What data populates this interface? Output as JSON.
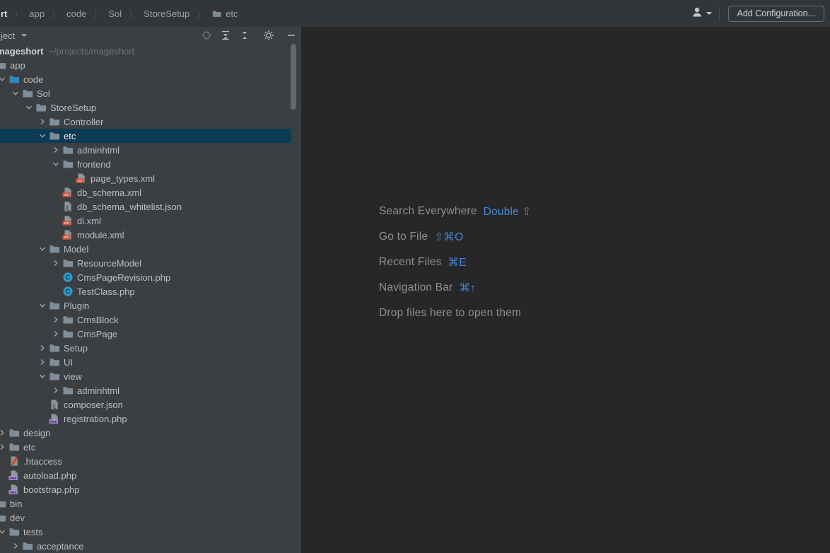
{
  "titlebar": {
    "breadcrumbs": [
      "rt",
      "app",
      "code",
      "Sol",
      "StoreSetup",
      "etc"
    ],
    "breadcrumb_folder_item": "etc",
    "add_configuration_label": "Add Configuration...",
    "user_icon": "user-dropdown"
  },
  "project_panel": {
    "title": "ject",
    "actions": [
      {
        "name": "select-opened-file",
        "icon": "locate-icon"
      },
      {
        "name": "expand-all",
        "icon": "expand-all-icon"
      },
      {
        "name": "collapse-all",
        "icon": "collapse-all-icon"
      },
      {
        "name": "settings",
        "icon": "gear-icon"
      },
      {
        "name": "hide",
        "icon": "minus-icon"
      }
    ],
    "tree": [
      {
        "label": "mageshort",
        "suffix": "~/projects/mageshort",
        "level": 0,
        "chevron": "open",
        "icon": "folder",
        "bold": true
      },
      {
        "label": "app",
        "level": 1,
        "chevron": "open",
        "icon": "folder"
      },
      {
        "label": "code",
        "level": 2,
        "chevron": "open",
        "icon": "folder-source"
      },
      {
        "label": "Sol",
        "level": 3,
        "chevron": "open",
        "icon": "folder"
      },
      {
        "label": "StoreSetup",
        "level": 4,
        "chevron": "open",
        "icon": "folder"
      },
      {
        "label": "Controller",
        "level": 5,
        "chevron": "closed",
        "icon": "folder"
      },
      {
        "label": "etc",
        "level": 5,
        "chevron": "open",
        "icon": "folder",
        "selected": true
      },
      {
        "label": "adminhtml",
        "level": 6,
        "chevron": "closed",
        "icon": "folder"
      },
      {
        "label": "frontend",
        "level": 6,
        "chevron": "open",
        "icon": "folder"
      },
      {
        "label": "page_types.xml",
        "level": 7,
        "chevron": null,
        "icon": "xml-file"
      },
      {
        "label": "db_schema.xml",
        "level": 6,
        "chevron": null,
        "icon": "xml-file"
      },
      {
        "label": "db_schema_whitelist.json",
        "level": 6,
        "chevron": null,
        "icon": "json-file"
      },
      {
        "label": "di.xml",
        "level": 6,
        "chevron": null,
        "icon": "xml-file"
      },
      {
        "label": "module.xml",
        "level": 6,
        "chevron": null,
        "icon": "xml-file"
      },
      {
        "label": "Model",
        "level": 5,
        "chevron": "open",
        "icon": "folder"
      },
      {
        "label": "ResourceModel",
        "level": 6,
        "chevron": "closed",
        "icon": "folder"
      },
      {
        "label": "CmsPageRevision.php",
        "level": 6,
        "chevron": null,
        "icon": "php-class"
      },
      {
        "label": "TestClass.php",
        "level": 6,
        "chevron": null,
        "icon": "php-class"
      },
      {
        "label": "Plugin",
        "level": 5,
        "chevron": "open",
        "icon": "folder"
      },
      {
        "label": "CmsBlock",
        "level": 6,
        "chevron": "closed",
        "icon": "folder"
      },
      {
        "label": "CmsPage",
        "level": 6,
        "chevron": "closed",
        "icon": "folder"
      },
      {
        "label": "Setup",
        "level": 5,
        "chevron": "closed",
        "icon": "folder"
      },
      {
        "label": "UI",
        "level": 5,
        "chevron": "closed",
        "icon": "folder"
      },
      {
        "label": "view",
        "level": 5,
        "chevron": "open",
        "icon": "folder"
      },
      {
        "label": "adminhtml",
        "level": 6,
        "chevron": "closed",
        "icon": "folder"
      },
      {
        "label": "composer.json",
        "level": 5,
        "chevron": null,
        "icon": "json-file"
      },
      {
        "label": "registration.php",
        "level": 5,
        "chevron": null,
        "icon": "php-file"
      },
      {
        "label": "design",
        "level": 2,
        "chevron": "closed",
        "icon": "folder"
      },
      {
        "label": "etc",
        "level": 2,
        "chevron": "closed",
        "icon": "folder"
      },
      {
        "label": ".htaccess",
        "level": 2,
        "chevron": null,
        "icon": "htaccess-file"
      },
      {
        "label": "autoload.php",
        "level": 2,
        "chevron": null,
        "icon": "php-file"
      },
      {
        "label": "bootstrap.php",
        "level": 2,
        "chevron": null,
        "icon": "php-file"
      },
      {
        "label": "bin",
        "level": 1,
        "chevron": "closed",
        "icon": "folder"
      },
      {
        "label": "dev",
        "level": 1,
        "chevron": "open",
        "icon": "folder"
      },
      {
        "label": "tests",
        "level": 2,
        "chevron": "open",
        "icon": "folder"
      },
      {
        "label": "acceptance",
        "level": 3,
        "chevron": "closed",
        "icon": "folder"
      }
    ]
  },
  "editor": {
    "hints": [
      {
        "label": "Search Everywhere",
        "shortcut": "Double ⇧"
      },
      {
        "label": "Go to File",
        "shortcut": "⇧⌘O"
      },
      {
        "label": "Recent Files",
        "shortcut": "⌘E"
      },
      {
        "label": "Navigation Bar",
        "shortcut": "⌘↑"
      },
      {
        "label": "Drop files here to open them",
        "shortcut": ""
      }
    ]
  },
  "colors": {
    "panel_bg": "#3C3F41",
    "editor_bg": "#272727",
    "titlebar_bg": "#333638",
    "selection_bg": "#0B3A55",
    "accent_blue": "#4186D8",
    "source_root_folder": "#3187B8",
    "folder_gray": "#808E99",
    "xml_badge": "#D4503A",
    "php_badge": "#A98BD9",
    "php_class_circle": "#2E9BC9"
  }
}
